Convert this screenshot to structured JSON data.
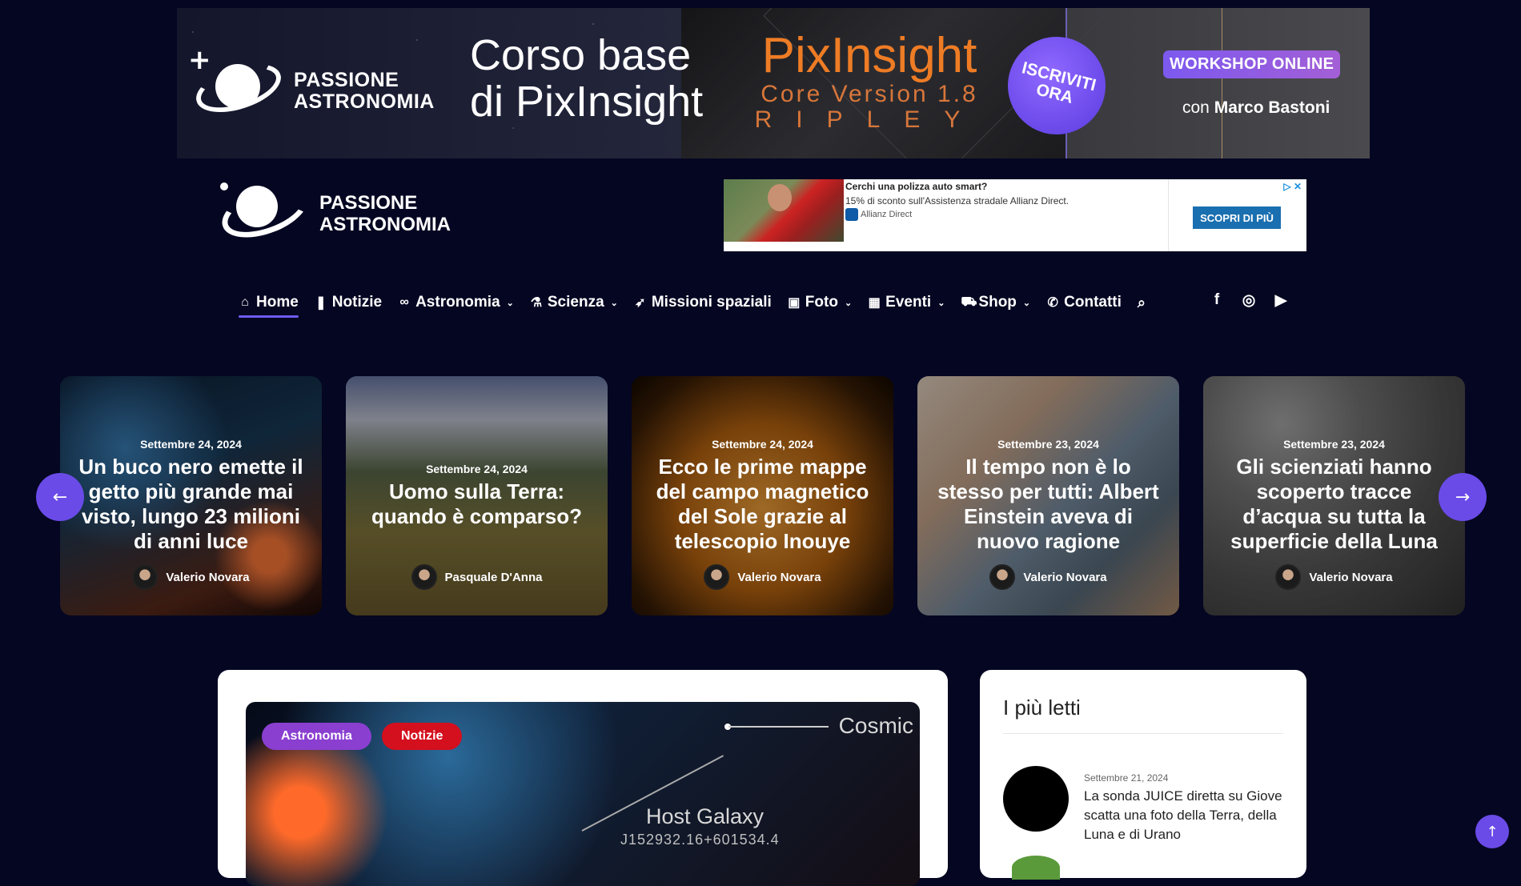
{
  "banner": {
    "brand": "PASSIONE\nASTRONOMIA",
    "course_line1": "Corso base",
    "course_line2": "di PixInsight",
    "pix_title": "PixInsight",
    "pix_version": "Core Version 1.8",
    "pix_ripley": "RIPLEY",
    "cta": "ISCRIVITI\nORA",
    "workshop": "WORKSHOP ONLINE",
    "con": "con",
    "presenter": "Marco Bastoni"
  },
  "header": {
    "logo_line1": "PASSIONE",
    "logo_line2": "ASTRONOMIA"
  },
  "ad": {
    "headline": "Cerchi una polizza auto smart?",
    "description": "15% di sconto sull'Assistenza stradale Allianz Direct.",
    "advertiser": "Allianz Direct",
    "cta": "SCOPRI DI PIÙ",
    "choices": "▷ ✕"
  },
  "nav": {
    "items": [
      {
        "label": "Home",
        "icon": "home-icon",
        "glyph": "⌂",
        "dropdown": false,
        "active": true
      },
      {
        "label": "Notizie",
        "icon": "bookmark-icon",
        "glyph": "🔖︎",
        "dropdown": false
      },
      {
        "label": "Astronomia",
        "icon": "binoculars-icon",
        "glyph": "∞",
        "dropdown": true
      },
      {
        "label": "Scienza",
        "icon": "flask-icon",
        "glyph": "⚗",
        "dropdown": true
      },
      {
        "label": "Missioni spaziali",
        "icon": "rocket-icon",
        "glyph": "➶",
        "dropdown": false
      },
      {
        "label": "Foto",
        "icon": "camera-icon",
        "glyph": "▣",
        "dropdown": true
      },
      {
        "label": "Eventi",
        "icon": "calendar-icon",
        "glyph": "▦",
        "dropdown": true
      },
      {
        "label": "Shop",
        "icon": "cart-icon",
        "glyph": "⛟",
        "dropdown": true
      },
      {
        "label": "Contatti",
        "icon": "phone-icon",
        "glyph": "✆",
        "dropdown": false
      }
    ],
    "search_glyph": "⌕",
    "socials": {
      "facebook": "f",
      "instagram": "◎",
      "youtube": "▶"
    }
  },
  "slider": [
    {
      "date": "Settembre 24, 2024",
      "title": "Un buco nero emette il getto più grande mai visto, lungo 23 milioni di anni luce",
      "author": "Valerio Novara"
    },
    {
      "date": "Settembre 24, 2024",
      "title": "Uomo sulla Terra: quando è comparso?",
      "author": "Pasquale D'Anna"
    },
    {
      "date": "Settembre 24, 2024",
      "title": "Ecco le prime mappe del campo magnetico del Sole grazie al telescopio Inouye",
      "author": "Valerio Novara"
    },
    {
      "date": "Settembre 23, 2024",
      "title": "Il tempo non è lo stesso per tutti: Albert Einstein aveva di nuovo ragione",
      "author": "Valerio Novara"
    },
    {
      "date": "Settembre 23, 2024",
      "title": "Gli scienziati hanno scoperto tracce d’acqua su tutta la superficie della Luna",
      "author": "Valerio Novara"
    }
  ],
  "slider_arrows": {
    "prev": "←",
    "next": "→"
  },
  "featured": {
    "tags": [
      "Astronomia",
      "Notizie"
    ],
    "image_text": {
      "cosmic": "Cosmic",
      "host": "Host Galaxy",
      "coord": "J152932.16+601534.4"
    }
  },
  "sidebar": {
    "heading": "I più letti",
    "items": [
      {
        "date": "Settembre 21, 2024",
        "title": "La sonda JUICE diretta su Giove scatta una foto della Terra, della Luna e di Urano"
      }
    ]
  },
  "to_top": "↑",
  "colors": {
    "accent": "#6a4be8",
    "tag_astronomia": "#8a3fd0",
    "tag_notizie": "#d40f1e",
    "background": "#050622"
  }
}
